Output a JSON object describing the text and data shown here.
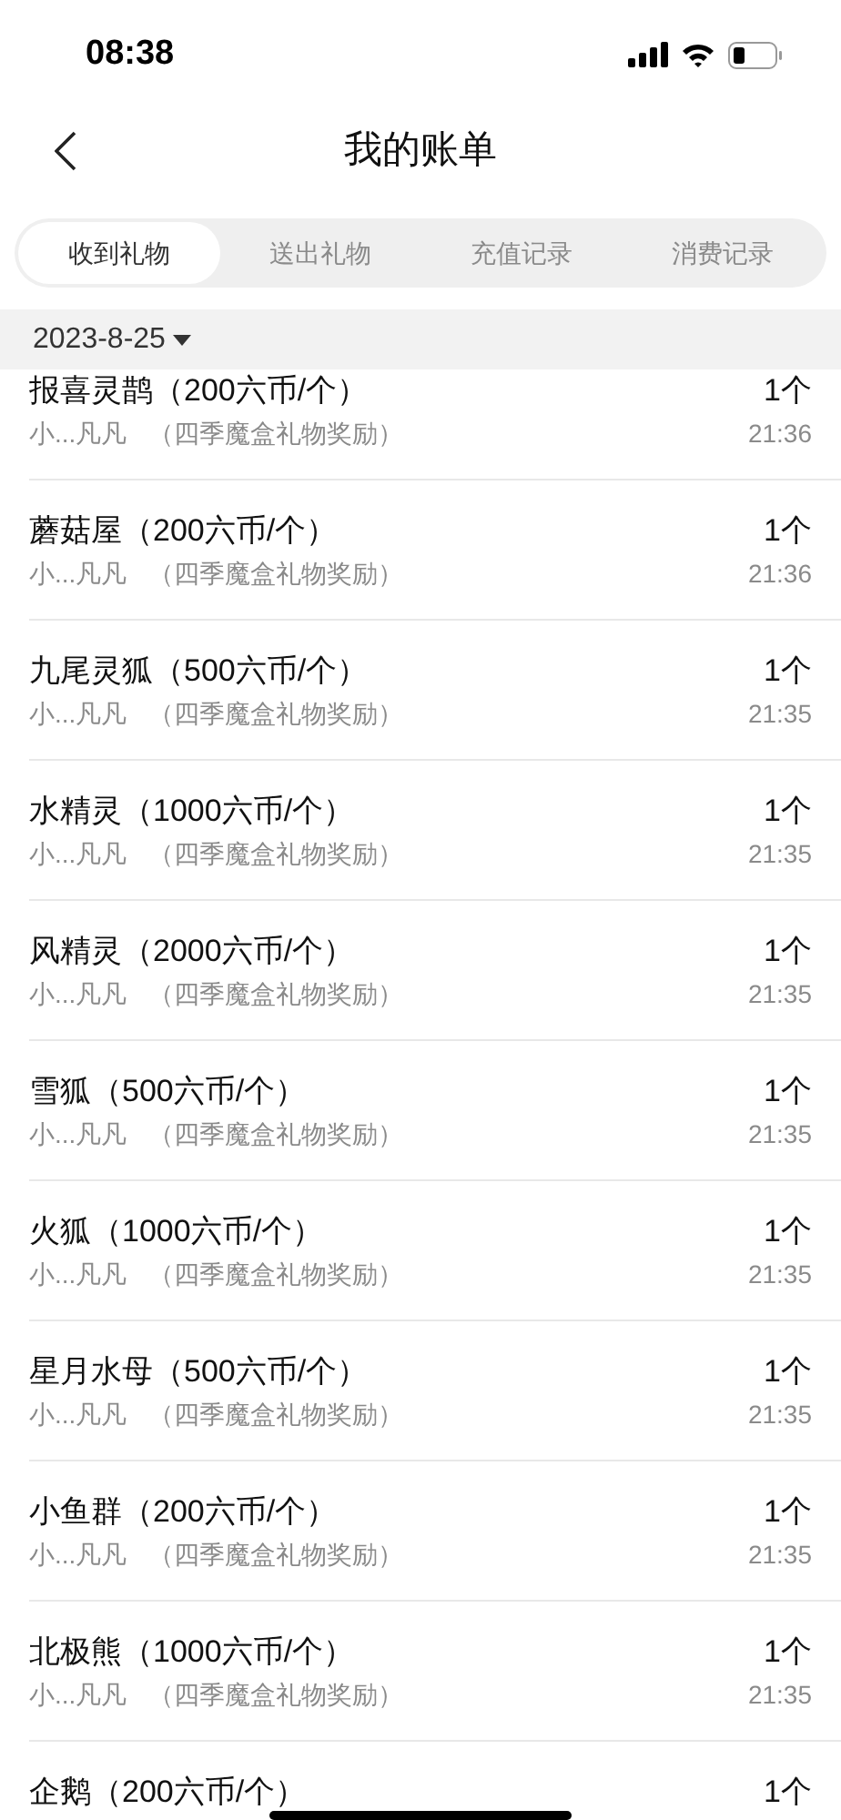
{
  "status_bar": {
    "time": "08:38"
  },
  "nav": {
    "title": "我的账单"
  },
  "tabs": [
    {
      "label": "收到礼物",
      "selected": true
    },
    {
      "label": "送出礼物",
      "selected": false
    },
    {
      "label": "充值记录",
      "selected": false
    },
    {
      "label": "消费记录",
      "selected": false
    }
  ],
  "date_header": {
    "date": "2023-8-25"
  },
  "records": [
    {
      "title": "报喜灵鹊（200六币/个）",
      "count": "1个",
      "sender": "小...凡凡",
      "source": "（四季魔盒礼物奖励）",
      "time": "21:36"
    },
    {
      "title": "蘑菇屋（200六币/个）",
      "count": "1个",
      "sender": "小...凡凡",
      "source": "（四季魔盒礼物奖励）",
      "time": "21:36"
    },
    {
      "title": "九尾灵狐（500六币/个）",
      "count": "1个",
      "sender": "小...凡凡",
      "source": "（四季魔盒礼物奖励）",
      "time": "21:35"
    },
    {
      "title": "水精灵（1000六币/个）",
      "count": "1个",
      "sender": "小...凡凡",
      "source": "（四季魔盒礼物奖励）",
      "time": "21:35"
    },
    {
      "title": "风精灵（2000六币/个）",
      "count": "1个",
      "sender": "小...凡凡",
      "source": "（四季魔盒礼物奖励）",
      "time": "21:35"
    },
    {
      "title": "雪狐（500六币/个）",
      "count": "1个",
      "sender": "小...凡凡",
      "source": "（四季魔盒礼物奖励）",
      "time": "21:35"
    },
    {
      "title": "火狐（1000六币/个）",
      "count": "1个",
      "sender": "小...凡凡",
      "source": "（四季魔盒礼物奖励）",
      "time": "21:35"
    },
    {
      "title": "星月水母（500六币/个）",
      "count": "1个",
      "sender": "小...凡凡",
      "source": "（四季魔盒礼物奖励）",
      "time": "21:35"
    },
    {
      "title": "小鱼群（200六币/个）",
      "count": "1个",
      "sender": "小...凡凡",
      "source": "（四季魔盒礼物奖励）",
      "time": "21:35"
    },
    {
      "title": "北极熊（1000六币/个）",
      "count": "1个",
      "sender": "小...凡凡",
      "source": "（四季魔盒礼物奖励）",
      "time": "21:35"
    },
    {
      "title": "企鹅（200六币/个）",
      "count": "1个"
    }
  ]
}
